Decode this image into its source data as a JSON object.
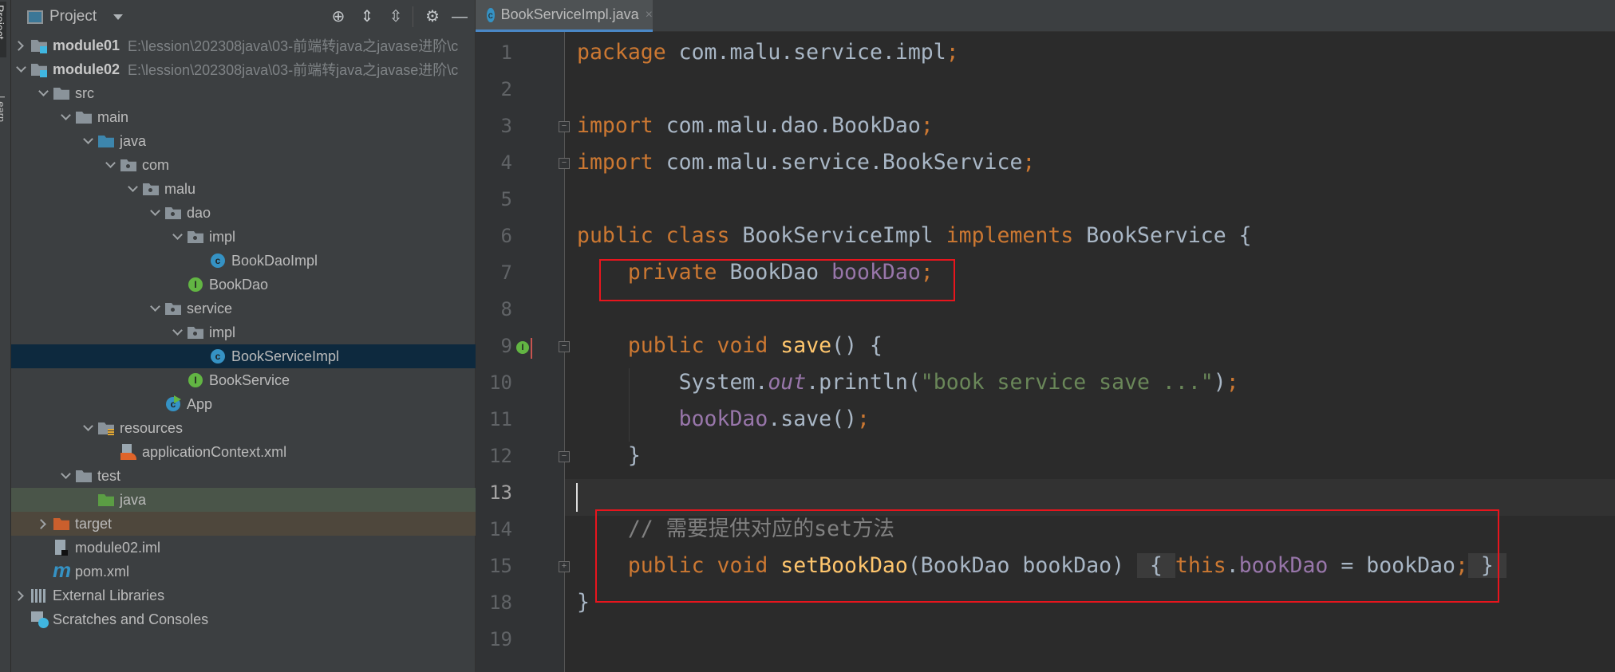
{
  "strip": {
    "project_tab": "Project",
    "learn_tab": "Learn"
  },
  "sidebar": {
    "title": "Project",
    "toolbar": [
      "locate-icon",
      "expand-all-icon",
      "collapse-all-icon",
      "gear-icon",
      "minimize-icon"
    ],
    "tree": [
      {
        "label": "module01",
        "path": "E:\\lession\\202308java\\03-前端转java之javase进阶\\c",
        "level": 0,
        "arrow": "closed",
        "icon": "folder module",
        "bold": true
      },
      {
        "label": "module02",
        "path": "E:\\lession\\202308java\\03-前端转java之javase进阶\\c",
        "level": 0,
        "arrow": "open",
        "icon": "folder module",
        "bold": true
      },
      {
        "label": "src",
        "level": 1,
        "arrow": "open",
        "icon": "folder"
      },
      {
        "label": "main",
        "level": 2,
        "arrow": "open",
        "icon": "folder"
      },
      {
        "label": "java",
        "level": 3,
        "arrow": "open",
        "icon": "folder src"
      },
      {
        "label": "com",
        "level": 4,
        "arrow": "open",
        "icon": "folder pkg"
      },
      {
        "label": "malu",
        "level": 5,
        "arrow": "open",
        "icon": "folder pkg"
      },
      {
        "label": "dao",
        "level": 6,
        "arrow": "open",
        "icon": "folder pkg"
      },
      {
        "label": "impl",
        "level": 7,
        "arrow": "open",
        "icon": "folder pkg"
      },
      {
        "label": "BookDaoImpl",
        "level": 8,
        "arrow": null,
        "icon": "cls"
      },
      {
        "label": "BookDao",
        "level": 7,
        "arrow": null,
        "icon": "intf"
      },
      {
        "label": "service",
        "level": 6,
        "arrow": "open",
        "icon": "folder pkg"
      },
      {
        "label": "impl",
        "level": 7,
        "arrow": "open",
        "icon": "folder pkg"
      },
      {
        "label": "BookServiceImpl",
        "level": 8,
        "arrow": null,
        "icon": "cls",
        "state": "sel"
      },
      {
        "label": "BookService",
        "level": 7,
        "arrow": null,
        "icon": "intf"
      },
      {
        "label": "App",
        "level": 6,
        "arrow": null,
        "icon": "cls app"
      },
      {
        "label": "resources",
        "level": 3,
        "arrow": "open",
        "icon": "folder res"
      },
      {
        "label": "applicationContext.xml",
        "level": 4,
        "arrow": null,
        "icon": "xml"
      },
      {
        "label": "test",
        "level": 2,
        "arrow": "open",
        "icon": "folder"
      },
      {
        "label": "java",
        "level": 3,
        "arrow": null,
        "icon": "folder testsrc",
        "state": "green"
      },
      {
        "label": "target",
        "level": 1,
        "arrow": "closed",
        "icon": "folder target",
        "state": "brown"
      },
      {
        "label": "module02.iml",
        "level": 1,
        "arrow": null,
        "icon": "iml"
      },
      {
        "label": "pom.xml",
        "level": 1,
        "arrow": null,
        "icon": "maven"
      },
      {
        "label": "External Libraries",
        "level": 0,
        "arrow": "closed",
        "icon": "lib"
      },
      {
        "label": "Scratches and Consoles",
        "level": 0,
        "arrow": null,
        "icon": "scratch"
      }
    ]
  },
  "editor": {
    "tab": {
      "label": "BookServiceImpl.java",
      "icon": "class-icon",
      "close": "×"
    },
    "current_line": "13",
    "lines": [
      {
        "n": "1",
        "t": [
          [
            "package",
            "k"
          ],
          [
            " com.malu.service.impl",
            ""
          ],
          [
            ";",
            "k"
          ]
        ]
      },
      {
        "n": "2",
        "t": []
      },
      {
        "n": "3",
        "t": [
          [
            "import",
            "k"
          ],
          [
            " com.malu.dao.BookDao",
            ""
          ],
          [
            ";",
            "k"
          ]
        ]
      },
      {
        "n": "4",
        "t": [
          [
            "import",
            "k"
          ],
          [
            " com.malu.service.BookService",
            ""
          ],
          [
            ";",
            "k"
          ]
        ]
      },
      {
        "n": "5",
        "t": []
      },
      {
        "n": "6",
        "t": [
          [
            "public class ",
            "k"
          ],
          [
            "BookServiceImpl ",
            ""
          ],
          [
            "implements ",
            "k"
          ],
          [
            "BookService {",
            ""
          ]
        ]
      },
      {
        "n": "7",
        "t": [
          [
            "    private ",
            "k"
          ],
          [
            "BookDao ",
            ""
          ],
          [
            "bookDao",
            "f"
          ],
          [
            ";",
            "k"
          ]
        ]
      },
      {
        "n": "8",
        "t": []
      },
      {
        "n": "9",
        "t": [
          [
            "    public void ",
            "k"
          ],
          [
            "save",
            "m"
          ],
          [
            "() {",
            ""
          ]
        ]
      },
      {
        "n": "10",
        "t": [
          [
            "        System.",
            ""
          ],
          [
            "out",
            "fi"
          ],
          [
            ".println(",
            ""
          ],
          [
            "\"book service save ...\"",
            "s"
          ],
          [
            ")",
            ""
          ],
          [
            ";",
            "k"
          ]
        ]
      },
      {
        "n": "11",
        "t": [
          [
            "        ",
            ""
          ],
          [
            "bookDao",
            "f"
          ],
          [
            ".save()",
            ""
          ],
          [
            ";",
            "k"
          ]
        ]
      },
      {
        "n": "12",
        "t": [
          [
            "    }",
            ""
          ]
        ]
      },
      {
        "n": "13",
        "t": []
      },
      {
        "n": "14",
        "t": [
          [
            "    // 需要提供对应的set方法",
            "c"
          ]
        ]
      },
      {
        "n": "15",
        "t": [
          [
            "    public void ",
            "k"
          ],
          [
            "setBookDao",
            "m"
          ],
          [
            "(BookDao bookDao)",
            ""
          ],
          [
            " ",
            ""
          ],
          [
            " { ",
            "fold"
          ],
          [
            "this",
            "k"
          ],
          [
            ".",
            ""
          ],
          [
            "bookDao",
            "f"
          ],
          [
            " = bookDao",
            ""
          ],
          [
            ";",
            "k"
          ],
          [
            " } ",
            "fold"
          ]
        ]
      },
      {
        "n": "18",
        "t": [
          [
            "}",
            ""
          ]
        ]
      },
      {
        "n": "19",
        "t": []
      }
    ]
  },
  "colors": {
    "keyword": "#cc7832",
    "method": "#ffc66d",
    "field": "#9876aa",
    "string": "#6a8759",
    "comment": "#808080",
    "highlight_box": "#e8151d"
  }
}
